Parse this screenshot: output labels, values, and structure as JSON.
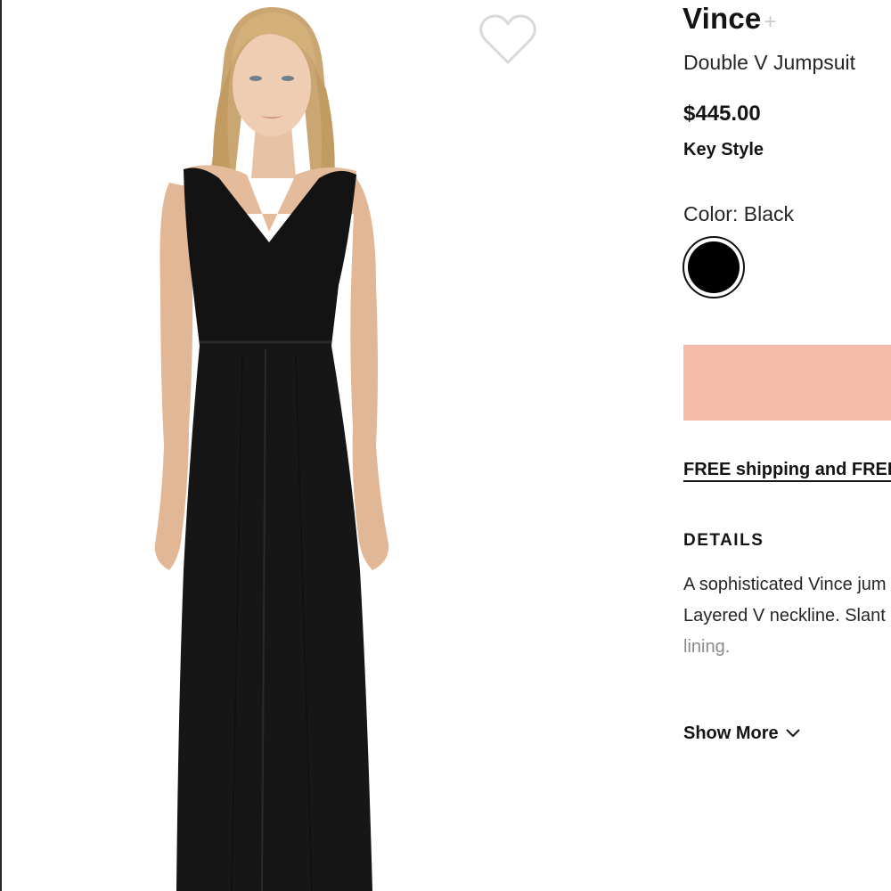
{
  "product": {
    "brand": "Vince",
    "brand_plus": "+",
    "name": "Double V Jumpsuit",
    "price": "$445.00",
    "tag": "Key Style"
  },
  "color": {
    "label": "Color: Black",
    "swatch_color": "#000000"
  },
  "add_to_bag": {
    "color": "#f5bcab"
  },
  "shipping": {
    "label": "FREE shipping and FREE"
  },
  "details": {
    "title": "DETAILS",
    "lines": [
      "A sophisticated Vince jum",
      "Layered V neckline. Slant",
      "lining."
    ]
  },
  "show_more": {
    "label": "Show More",
    "icon": "chevron-down-icon"
  },
  "icons": {
    "wishlist": "heart-icon"
  }
}
